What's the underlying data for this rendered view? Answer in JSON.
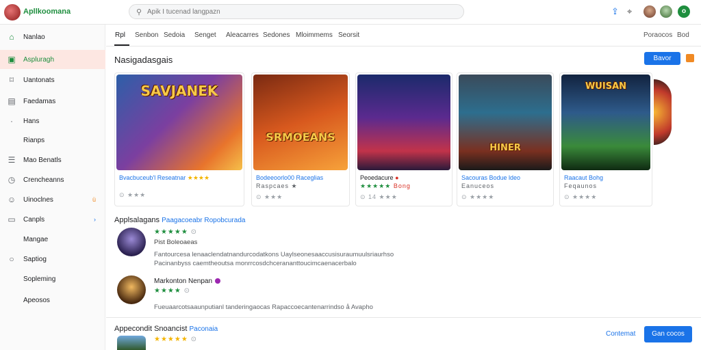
{
  "app": {
    "title": "Apllkoomana"
  },
  "search": {
    "placeholder": "Apik I tucenad langpazn"
  },
  "sidebar": {
    "items": [
      {
        "label": "Nanlao",
        "icon": "home-icon"
      },
      {
        "label": "Aspluragh",
        "icon": "apps-icon"
      },
      {
        "label": "Uantonats",
        "icon": "bookmark-icon"
      },
      {
        "label": "Faedamas",
        "icon": "calendar-icon"
      },
      {
        "label": "Hans",
        "icon": "dot-icon"
      },
      {
        "label": "Rianps",
        "icon": ""
      },
      {
        "label": "Mao Benatls",
        "icon": "list-icon"
      },
      {
        "label": "Crencheanns",
        "icon": "history-icon"
      },
      {
        "label": "Uinoclnes",
        "icon": "person-icon",
        "trail": "ü"
      },
      {
        "label": "Canpls",
        "icon": "folder-icon",
        "trail": "›"
      },
      {
        "label": "Mangae",
        "icon": ""
      },
      {
        "label": "Saptiog",
        "icon": "circle-icon"
      },
      {
        "label": "Sopleming",
        "icon": ""
      },
      {
        "label": "Apeosos",
        "icon": ""
      }
    ]
  },
  "tabs": [
    "Rpl",
    "Senbon",
    "Sedoia",
    "Senget",
    "Aleacarres",
    "Sedones",
    "Mloimmems",
    "Seorsit"
  ],
  "tabs_right": [
    "Poraocos",
    "Bod"
  ],
  "section": {
    "title": "Nasigadasgais",
    "button": "Bavor"
  },
  "cards": [
    {
      "art": "SAVJANEK",
      "title": "Bvacbuceub'l Reseatnar",
      "stars": "★★★★",
      "meta": "⊙ ★★★"
    },
    {
      "art": "SRMOEANS",
      "title": "Bodeeoorlo00 Raceglias",
      "sub": "Raspcaes ★",
      "meta": "⊙ ★★★"
    },
    {
      "art": "",
      "title": "Peoedacure",
      "stars": "★★★★★",
      "sub": "Bong",
      "meta": "⊙ 14 ★★★"
    },
    {
      "art": "HINER",
      "title": "Sacouras Bodue ldeo",
      "sub": "Eanuceos",
      "meta": "⊙ ★★★★"
    },
    {
      "art": "WUISAN",
      "title": "Raacaut Bohg",
      "sub": "Feqaunos",
      "meta": "⊙ ★★★★"
    }
  ],
  "reviews": {
    "title": "Applsalagans",
    "link": "Paagacoeabr Ropobcurada",
    "items": [
      {
        "name": "",
        "stars": "★★★★★",
        "sub": "Pist Boleoaeas",
        "text1": "Fantourcesa lenaaclendatnandurcodatkons Uaylseonesaaccusisuraumuulsriaurhso",
        "text2": "Pacinanbyss caemtheoutsa monrrcosdchcerananttoucimcaenacerbalo"
      },
      {
        "name": "Markonton Nenpan",
        "stars": "★★★★",
        "text1": "Fueuaarcotsaaunputianl tanderingaocas Rapaccoecantenarrindso å Avapho"
      }
    ]
  },
  "bottom": {
    "title": "Appecondit Snoancist",
    "link": "Paconaia",
    "stars": "★★★★★",
    "link_button": "Contemat",
    "button": "Gan cocos"
  },
  "colors": {
    "accent": "#1a73e8",
    "brand": "#1e8e3e",
    "active_bg": "#fde7e2"
  }
}
